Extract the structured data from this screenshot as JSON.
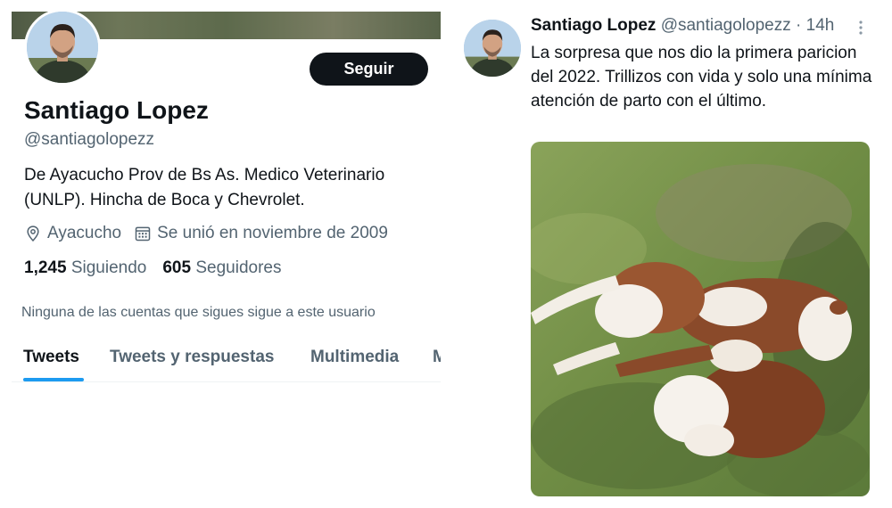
{
  "profile": {
    "display_name": "Santiago Lopez",
    "handle": "@santiagolopezz",
    "follow_button": "Seguir",
    "bio_line1": "De Ayacucho Prov de Bs As. Medico Veterinario",
    "bio_line2": "(UNLP). Hincha de Boca y Chevrolet.",
    "location": "Ayacucho",
    "joined": "Se unió en noviembre de 2009",
    "following_count": "1,245",
    "following_label": "Siguiendo",
    "followers_count": "605",
    "followers_label": "Seguidores",
    "not_followed_notice": "Ninguna de las cuentas que sigues sigue a este usuario",
    "icons": {
      "location": "location-pin-icon",
      "joined": "calendar-icon"
    }
  },
  "tabs": [
    {
      "label": "Tweets",
      "active": true
    },
    {
      "label": "Tweets y respuestas",
      "active": false
    },
    {
      "label": "Multimedia",
      "active": false
    },
    {
      "label": "Me gusta",
      "active": false
    }
  ],
  "tweet": {
    "author_name": "Santiago Lopez",
    "author_handle": "@santiagolopezz",
    "separator": "·",
    "time": "14h",
    "text": "La sorpresa que nos dio la primera paricion del 2022. Trillizos con vida y solo una mínima atención de parto con el último.",
    "more_icon": "more-dots-icon"
  },
  "colors": {
    "text": "#0f1419",
    "muted": "#536471",
    "accent": "#1d9bf0",
    "button": "#0f1419",
    "divider": "#eff3f4"
  }
}
